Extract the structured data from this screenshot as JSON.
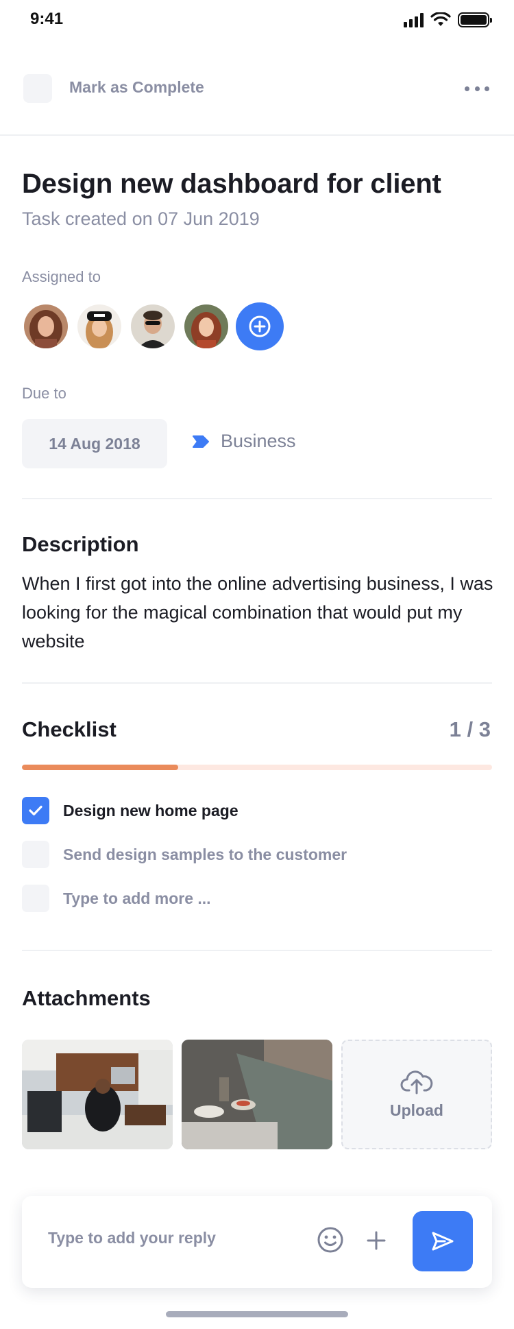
{
  "status_bar": {
    "time": "9:41"
  },
  "header": {
    "mark_complete_label": "Mark as Complete"
  },
  "task": {
    "title": "Design new dashboard for client",
    "created": "Task created on 07 Jun 2019"
  },
  "assigned": {
    "label": "Assigned to"
  },
  "due": {
    "label": "Due to",
    "date": "14 Aug 2018",
    "category": "Business"
  },
  "description": {
    "heading": "Description",
    "text": "When I first got into the online advertising business, I was looking for the magical combination that would put my website"
  },
  "checklist": {
    "heading": "Checklist",
    "count": "1 / 3",
    "progress_fraction": 0.333,
    "items": [
      {
        "label": "Design new home page",
        "checked": true
      },
      {
        "label": "Send design samples to the customer",
        "checked": false
      },
      {
        "label": "Type to add more ...",
        "checked": false
      }
    ]
  },
  "attachments": {
    "heading": "Attachments",
    "upload_label": "Upload"
  },
  "reply": {
    "placeholder": "Type to add your reply"
  },
  "colors": {
    "accent": "#3d7bf5",
    "progress": "#ea8b5b",
    "progress_track": "#fde8e1",
    "muted_text": "#8a8ea3"
  }
}
